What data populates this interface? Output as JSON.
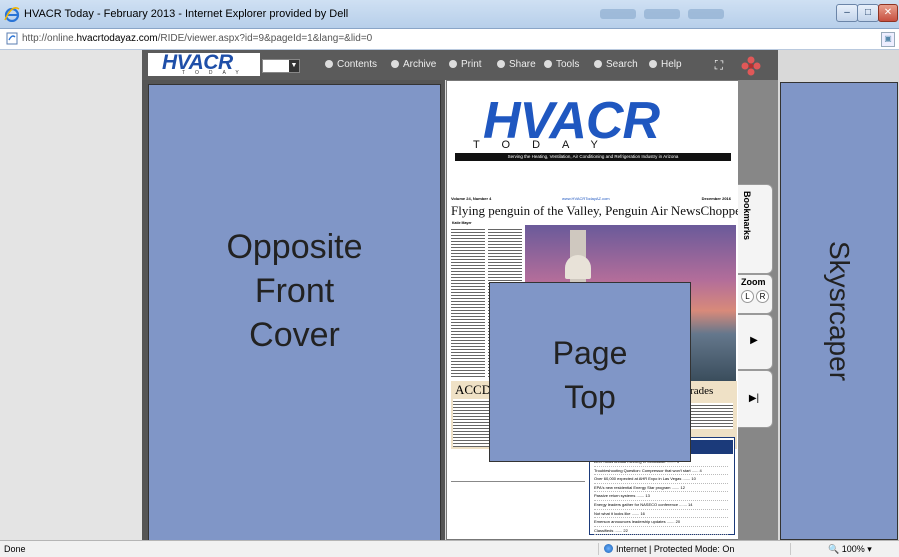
{
  "window": {
    "title": "HVACR Today - February 2013 - Internet Explorer provided by Dell",
    "minimize": "–",
    "maximize": "□",
    "close": "✕"
  },
  "address": {
    "url_prefix": "http://online.",
    "url_domain": "hvacrtodayaz.com",
    "url_rest": "/RIDE/viewer.aspx?id=9&pageId=1&lang=&lid=0"
  },
  "toolbar": {
    "logo_text": "HVACR",
    "logo_sub": "TODAY",
    "items": [
      "Contents",
      "Archive",
      "Print",
      "Share",
      "Tools",
      "Search",
      "Help"
    ]
  },
  "ads": {
    "left": "Opposite\nFront\nCover",
    "top": "Page\nTop",
    "right": "Skysrcaper"
  },
  "magazine": {
    "masthead": "HVACR",
    "masthead_sub": "TODAY",
    "tagline": "Serving the Heating, Ventilation, Air Conditioning and Refrigeration Industry in Arizona",
    "volume": "Volume 24, Number 4",
    "website": "www.HVACRTodayAZ.com",
    "date": "December 2016",
    "headline": "Flying penguin of the Valley, Penguin Air NewsChopper",
    "byline": "Katie Mayer",
    "section_left": "ACCD",
    "section_right": "trades",
    "inside_title": "Inside",
    "inside_items": [
      "AHR holds annual meeting in Scottsdale ........ 3",
      "Troubleshooting Question: Compressor that won't start ...... 4",
      "Over 60,000 expected at AHR Expo in Las Vegas ....... 10",
      "EPA's new residential Energy Star program ....... 12",
      "Passive return systems ....... 13",
      "Energy leaders gather for NASECO conference ....... 14",
      "Not what it looks like ....... 16",
      "Emerson announces leadership updates ....... 20",
      "Classifieds ....... 22"
    ]
  },
  "side_tabs": {
    "bookmarks": "Bookmarks",
    "zoom": "Zoom",
    "zoom_left": "L",
    "zoom_right": "R"
  },
  "status": {
    "done": "Done",
    "zone": "Internet | Protected Mode: On",
    "zoom": "100%"
  }
}
